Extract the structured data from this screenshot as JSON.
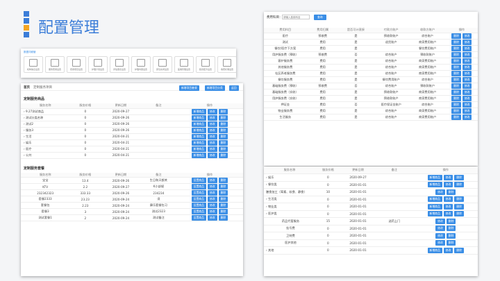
{
  "slide_title": "配置管理",
  "logo_colors": [
    "#3b7dd8",
    "#3b7dd8",
    "#f5a623",
    "#3b7dd8"
  ],
  "icons_panel": {
    "title": "数据词频管",
    "items": [
      "机构信息设置",
      "服务费用设置",
      "费用项目设置",
      "护理计划设置",
      "评估量表设置",
      "护理内容设置",
      "床位房间设置",
      "医嘱管理设置",
      "膳食配方设置",
      "收费标准设置"
    ]
  },
  "left_panel": {
    "breadcrumb_home": "首页",
    "breadcrumb_current": "定制服务项目",
    "btn_add_category": "新增项目套餐",
    "btn_add_item": "新增项目分类",
    "btn_return": "返回",
    "section1_title": "定制服务商品",
    "headers1": [
      "服务名称",
      "服务价格",
      "更新日期",
      "备注",
      "操作"
    ],
    "rows1": [
      {
        "name": "9.27测试商品",
        "price": "0",
        "date": "2020-09-27",
        "note": ""
      },
      {
        "name": "测试分类名称",
        "price": "0",
        "date": "2020-09-26",
        "note": ""
      },
      {
        "name": "测试2",
        "price": "0",
        "date": "2020-09-26",
        "note": ""
      },
      {
        "name": "服务3",
        "price": "0",
        "date": "2020-09-26",
        "note": ""
      },
      {
        "name": "生活",
        "price": "0",
        "date": "2020-04-21",
        "note": ""
      },
      {
        "name": "娱乐",
        "price": "0",
        "date": "2020-04-21",
        "note": ""
      },
      {
        "name": "医疗",
        "price": "0",
        "date": "2020-04-21",
        "note": ""
      },
      {
        "name": "公共",
        "price": "0",
        "date": "2020-04-21",
        "note": ""
      }
    ],
    "row_btns": [
      "新增商品",
      "修改",
      "删除"
    ],
    "section2_title": "定制服务套餐",
    "headers2": [
      "服务名称",
      "服务价格",
      "更新日期",
      "备注",
      "操作"
    ],
    "rows2": [
      {
        "name": "宝宝",
        "price": "13.4",
        "date": "2020-09-26",
        "note": "生日和天都关"
      },
      {
        "name": "KTV",
        "price": "2.2",
        "date": "2020-09-27",
        "note": "K小部规"
      },
      {
        "name": "232342323",
        "price": "333.33",
        "date": "2020-09-26",
        "note": "234234"
      },
      {
        "name": "套餐2333",
        "price": "23.23",
        "date": "2020-09-24",
        "note": "须"
      },
      {
        "name": "套餐包",
        "price": "2.23",
        "date": "2020-09-24",
        "note": "康乐套餐包习"
      },
      {
        "name": "套餐3",
        "price": "3",
        "date": "2020-09-24",
        "note": "测试2323"
      },
      {
        "name": "测试套餐1",
        "price": "2",
        "date": "2020-09-24",
        "note": "测试备注"
      }
    ],
    "row2_btns": [
      "设置商品",
      "修改",
      "删除"
    ]
  },
  "top_right_panel": {
    "label": "费用科目：",
    "placeholder": "请输入费用科目",
    "search_btn": "查询",
    "headers": [
      "费用科目",
      "费用归属",
      "是否可计直接",
      "付款方账户",
      "收款方账户",
      "操作"
    ],
    "rows": [
      {
        "a": "医疗",
        "b": "预收费",
        "c": "是",
        "d": "预收款账户",
        "e": "综合账户"
      },
      {
        "a": "测试",
        "b": "费用",
        "c": "是",
        "d": "退货账户",
        "e": "商家费用账户"
      },
      {
        "a": "餐饮/医疗下方案",
        "b": "费用",
        "c": "是",
        "d": "",
        "e": "餐饮费用账户"
      },
      {
        "a": "用护服务费（预收）",
        "b": "预收费",
        "c": "否",
        "d": "综合账户",
        "e": "预收款账户"
      },
      {
        "a": "客护服务费",
        "b": "费用",
        "c": "是",
        "d": "综合账户",
        "e": "商家费用账户"
      },
      {
        "a": "其他服务费",
        "b": "费用",
        "c": "是",
        "d": "综合账户",
        "e": "商家费用账户"
      },
      {
        "a": "社区养老服务费",
        "b": "费用",
        "c": "是",
        "d": "综合账户",
        "e": "商家费用账户"
      },
      {
        "a": "餐饮服务费",
        "b": "费用",
        "c": "是",
        "d": "餐饮费用账户",
        "e": "综合账户"
      },
      {
        "a": "基础服务费（预收）",
        "b": "预收费",
        "c": "否",
        "d": "综合账户",
        "e": "预收款账户"
      },
      {
        "a": "基础服务费（实收）",
        "b": "费用",
        "c": "是",
        "d": "预收款账户",
        "e": "商家费用账户"
      },
      {
        "a": "用护服务费（实收）",
        "b": "费用",
        "c": "是",
        "d": "预收款账户",
        "e": "商家费用账户"
      },
      {
        "a": "押证金",
        "b": "费用",
        "c": "否",
        "d": "医疗保证金账户",
        "e": "综合账户"
      },
      {
        "a": "物业服务费",
        "b": "费用",
        "c": "是",
        "d": "综合账户",
        "e": "商家费用账户"
      },
      {
        "a": "生活服务",
        "b": "费用",
        "c": "是",
        "d": "综合账户",
        "e": "商家费用账户"
      }
    ],
    "row_btns": [
      "删除",
      "修改"
    ]
  },
  "bottom_right_panel": {
    "headers": [
      "服务名称",
      "服务价格",
      "更新日期",
      "备注",
      "操作"
    ],
    "rows": [
      {
        "name": "› 娱乐",
        "price": "0",
        "date": "2020-09-27",
        "note": "",
        "btns": [
          "新增商品",
          "修改",
          "删除"
        ],
        "indent": false
      },
      {
        "name": "› 餐饮类",
        "price": "0",
        "date": "2020-01-01",
        "note": "",
        "btns": [
          "新增商品",
          "修改",
          "删除"
        ],
        "indent": false
      },
      {
        "name": "膳食加工（荤素、软食、静食）",
        "price": "10",
        "date": "2020-01-01",
        "note": "",
        "btns": [
          "修改",
          "删除"
        ],
        "indent": false
      },
      {
        "name": "› 生活类",
        "price": "0",
        "date": "2020-01-01",
        "note": "",
        "btns": [
          "新增商品",
          "修改",
          "删除"
        ],
        "indent": false
      },
      {
        "name": "› 物业类",
        "price": "0",
        "date": "2020-01-01",
        "note": "",
        "btns": [
          "新增商品",
          "修改",
          "删除"
        ],
        "indent": false
      },
      {
        "name": "› 医护类",
        "price": "0",
        "date": "2020-01-01",
        "note": "",
        "btns": [
          "新增商品",
          "修改",
          "删除"
        ],
        "indent": false
      },
      {
        "name": "药品代管服务",
        "price": "15",
        "date": "2020-01-01",
        "note": "送药上门",
        "btns": [
          "修改",
          "删除"
        ],
        "indent": true
      },
      {
        "name": "挂号费",
        "price": "0",
        "date": "2020-01-01",
        "note": "",
        "btns": [
          "修改",
          "删除"
        ],
        "indent": true
      },
      {
        "name": "卫材费",
        "price": "0",
        "date": "2020-01-01",
        "note": "",
        "btns": [
          "修改",
          "删除"
        ],
        "indent": true
      },
      {
        "name": "医护其他",
        "price": "0",
        "date": "2020-01-01",
        "note": "",
        "btns": [
          "修改",
          "删除"
        ],
        "indent": true
      },
      {
        "name": "› 其他",
        "price": "0",
        "date": "2020-01-01",
        "note": "",
        "btns": [
          "新增商品",
          "修改",
          "删除"
        ],
        "indent": false
      }
    ]
  }
}
